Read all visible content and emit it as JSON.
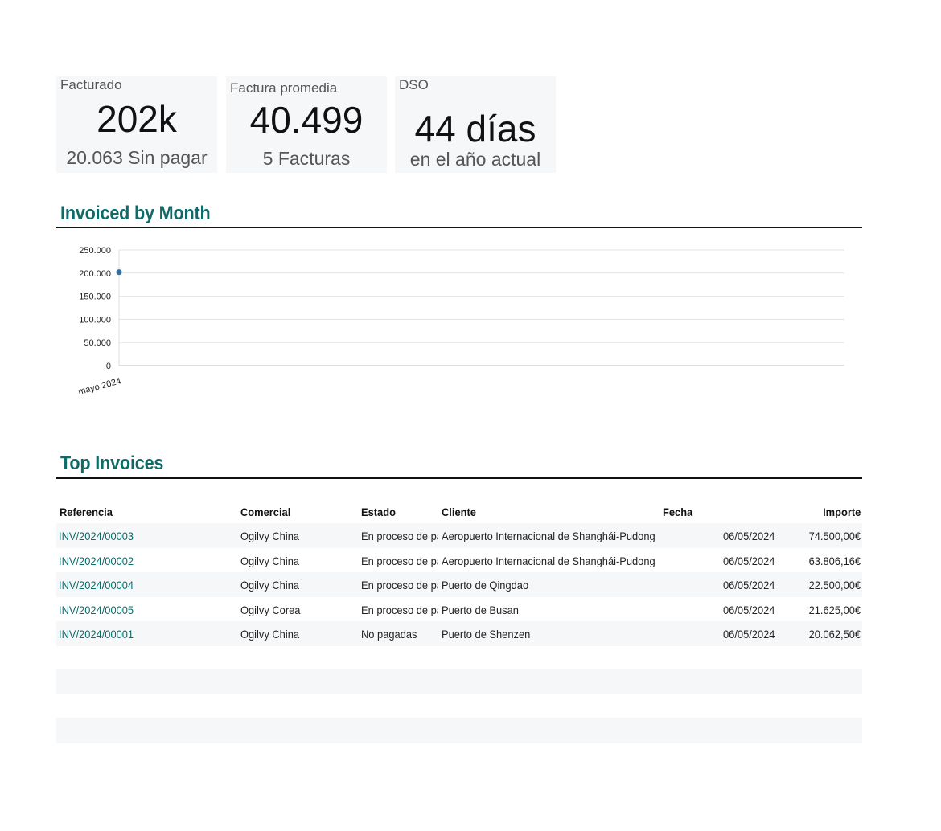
{
  "kpis": [
    {
      "label": "Facturado",
      "value": "202k",
      "sub_value": "20.063",
      "sub_label": "Sin pagar"
    },
    {
      "label": "Factura promedia",
      "value": "40.499",
      "sub_value": "5",
      "sub_label": "Facturas"
    },
    {
      "label": "DSO",
      "value": "44 días",
      "sub_value": "",
      "sub_label": "en el año actual"
    }
  ],
  "sections": {
    "invoiced_by_month": "Invoiced by Month",
    "top_invoices": "Top Invoices"
  },
  "chart_data": {
    "type": "scatter",
    "title": "",
    "xlabel": "",
    "ylabel": "",
    "categories": [
      "mayo 2024"
    ],
    "values": [
      202000
    ],
    "ylim": [
      0,
      250000
    ],
    "yticks": [
      "0",
      "50.000",
      "100.000",
      "150.000",
      "200.000",
      "250.000"
    ],
    "yticks_values": [
      0,
      50000,
      100000,
      150000,
      200000,
      250000
    ],
    "grid": true,
    "color": "#2e6fa7"
  },
  "table": {
    "headers": {
      "ref": "Referencia",
      "com": "Comercial",
      "est": "Estado",
      "cli": "Cliente",
      "fec": "Fecha",
      "imp": "Importe"
    },
    "rows": [
      {
        "ref": "INV/2024/00003",
        "com": "Ogilvy China",
        "est": "En proceso de pago",
        "cli": "Aeropuerto Internacional de Shanghái-Pudong",
        "fec": "06/05/2024",
        "imp": "74.500,00€"
      },
      {
        "ref": "INV/2024/00002",
        "com": "Ogilvy China",
        "est": "En proceso de pago",
        "cli": "Aeropuerto Internacional de Shanghái-Pudong",
        "fec": "06/05/2024",
        "imp": "63.806,16€"
      },
      {
        "ref": "INV/2024/00004",
        "com": "Ogilvy China",
        "est": "En proceso de pago",
        "cli": "Puerto de Qingdao",
        "fec": "06/05/2024",
        "imp": "22.500,00€"
      },
      {
        "ref": "INV/2024/00005",
        "com": "Ogilvy Corea",
        "est": "En proceso de pago",
        "cli": "Puerto de Busan",
        "fec": "06/05/2024",
        "imp": "21.625,00€"
      },
      {
        "ref": "INV/2024/00001",
        "com": "Ogilvy China",
        "est": "No pagadas",
        "cli": "Puerto de Shenzen",
        "fec": "06/05/2024",
        "imp": "20.062,50€"
      }
    ]
  }
}
